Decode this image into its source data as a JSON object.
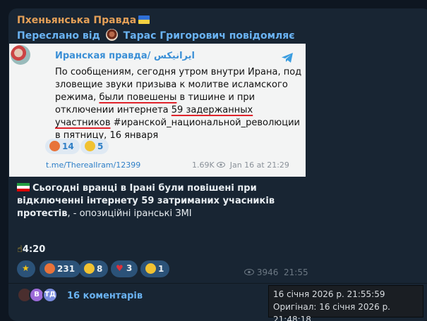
{
  "post": {
    "channel_name": "Пхеньянська Правда",
    "forwarded_prefix": "Переслано від",
    "forwarded_from": "Тарас Григорович повідомляє"
  },
  "preview": {
    "title": "Иранская правда/ ایرانیکس",
    "text_1": "По сообщениям, сегодня утром внутри Ирана, под зловещие звуки призыва к молитве исламского режима, ",
    "text_u1": "были повешены",
    "text_2": " в тишине и при отключении интернета ",
    "text_u2": "59 задержанных участников",
    "text_3": " #иранской_национальной_революции в пятницу, 16 января",
    "reactions": [
      {
        "count": "14",
        "emoji": "angry-face-icon"
      },
      {
        "count": "5",
        "emoji": "crying-face-icon"
      }
    ],
    "link": "t.me/TherealIram/12399",
    "views": "1.69K",
    "date": "Jan 16 at 21:29"
  },
  "main": {
    "text_bold": "Сьогодні вранці в Ірані були повішені при відключенні інтернету 59 затриманих учасників протестів",
    "text_rest": ", - опозиційні іранські ЗМІ",
    "footnote": "4:20"
  },
  "reactions": [
    {
      "emoji": "star-icon",
      "count": ""
    },
    {
      "emoji": "angry-face-icon",
      "count": "231"
    },
    {
      "emoji": "grimacing-face-icon",
      "count": "8"
    },
    {
      "emoji": "heart-icon",
      "count": "3"
    },
    {
      "emoji": "crying-face-icon",
      "count": "1"
    }
  ],
  "meta": {
    "views": "3946",
    "time": "21:55"
  },
  "comments": {
    "avatars": [
      "",
      "В",
      "ТД"
    ],
    "label": "16 коментарів"
  },
  "tooltip": {
    "line1": "16 січня 2026 р. 21:55:59",
    "line2": "Оригінал: 16 січня 2026 р. 21:48:18"
  },
  "colors": {
    "accent": "#6ab3f3",
    "channel": "#e4a058",
    "reaction_bg": "#2b5278",
    "underline": "#e0232b"
  }
}
